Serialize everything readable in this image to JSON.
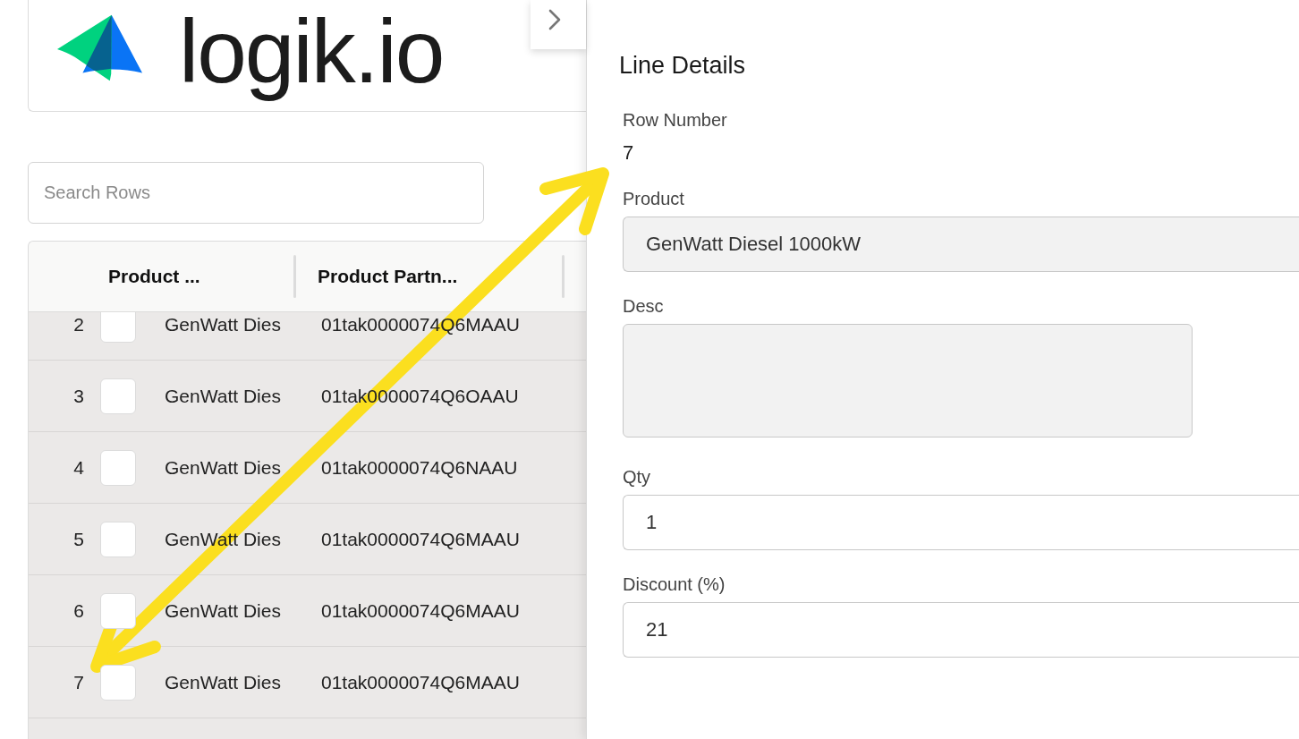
{
  "logo": {
    "wordmark": "logik.io"
  },
  "search": {
    "placeholder": "Search Rows"
  },
  "table": {
    "columns": [
      {
        "label": "Product ..."
      },
      {
        "label": "Product Partn..."
      }
    ],
    "rows": [
      {
        "number": "2",
        "checked": false,
        "product": "GenWatt Dies",
        "partner": "01tak0000074Q6MAAU"
      },
      {
        "number": "3",
        "checked": false,
        "product": "GenWatt Dies",
        "partner": "01tak0000074Q6OAAU"
      },
      {
        "number": "4",
        "checked": false,
        "product": "GenWatt Dies",
        "partner": "01tak0000074Q6NAAU"
      },
      {
        "number": "5",
        "checked": false,
        "product": "GenWatt Dies",
        "partner": "01tak0000074Q6MAAU"
      },
      {
        "number": "6",
        "checked": false,
        "product": "GenWatt Dies",
        "partner": "01tak0000074Q6MAAU"
      },
      {
        "number": "7",
        "checked": false,
        "product": "GenWatt Dies",
        "partner": "01tak0000074Q6MAAU"
      }
    ]
  },
  "details": {
    "title": "Line Details",
    "fields": [
      {
        "kind": "text",
        "label": "Row Number",
        "value": "7"
      },
      {
        "kind": "input",
        "label": "Product",
        "value": "GenWatt Diesel 1000kW",
        "disabled": true
      },
      {
        "kind": "textarea",
        "label": "Desc",
        "disabled": true
      },
      {
        "kind": "input",
        "label": "Qty",
        "value": "1",
        "disabled": false
      },
      {
        "kind": "input",
        "label": "Discount (%)",
        "value": "21",
        "disabled": false
      }
    ]
  }
}
